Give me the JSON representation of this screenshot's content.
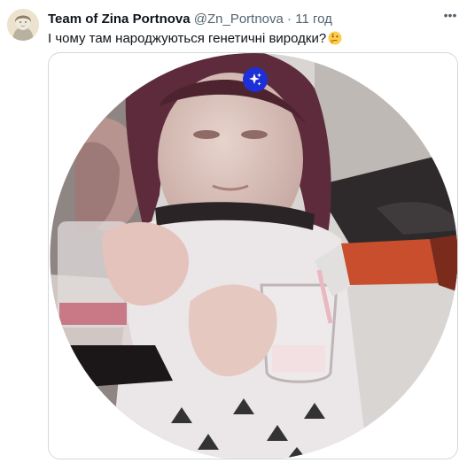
{
  "tweet": {
    "author_name": "Team of Zina Portnova",
    "author_handle": "@Zn_Portnova",
    "separator": "·",
    "timestamp": "11 год",
    "text": "І чому там народжуються генетичні виродки?",
    "emoji": "thinking-face"
  },
  "icons": {
    "more": "more-options-icon",
    "media_badge": "sparkles-icon"
  },
  "colors": {
    "text": "#0f1419",
    "secondary": "#536471",
    "border": "#cfd9de",
    "badge": "#1d2fd6"
  }
}
